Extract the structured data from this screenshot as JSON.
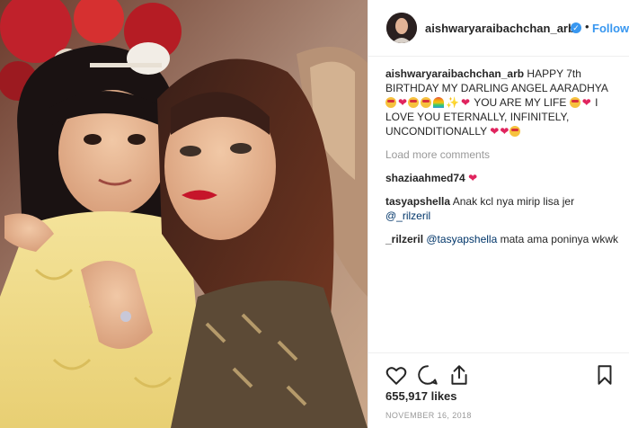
{
  "header": {
    "username": "aishwaryaraibachchan_arb",
    "verified_icon": "verified-badge-icon",
    "separator": "•",
    "follow_label": "Follow"
  },
  "caption": {
    "username": "aishwaryaraibachchan_arb",
    "text_part1": "HAPPY 7th BIRTHDAY MY DARLING ANGEL AARADHYA",
    "text_part2": "YOU ARE MY LIFE",
    "text_part3": "I LOVE YOU ETERNALLY, INFINITELY, UNCONDITIONALLY"
  },
  "load_more_label": "Load more comments",
  "comments": [
    {
      "username": "shaziaahmed74",
      "text": ""
    },
    {
      "username": "tasyapshella",
      "text": "Anak kcl nya mirip lisa jer",
      "mention": "@_rilzeril"
    },
    {
      "username": "_rilzeril",
      "mention": "@tasyapshella",
      "text": "mata ama poninya wkwk"
    }
  ],
  "actions": {
    "like_icon": "heart-icon",
    "comment_icon": "comment-icon",
    "share_icon": "share-icon",
    "save_icon": "bookmark-icon"
  },
  "likes_label": "655,917 likes",
  "date_label": "NOVEMBER 16, 2018",
  "colors": {
    "accent": "#3897f0",
    "text": "#262626",
    "muted": "#999999",
    "heart": "#e0245e",
    "mention": "#003569"
  }
}
